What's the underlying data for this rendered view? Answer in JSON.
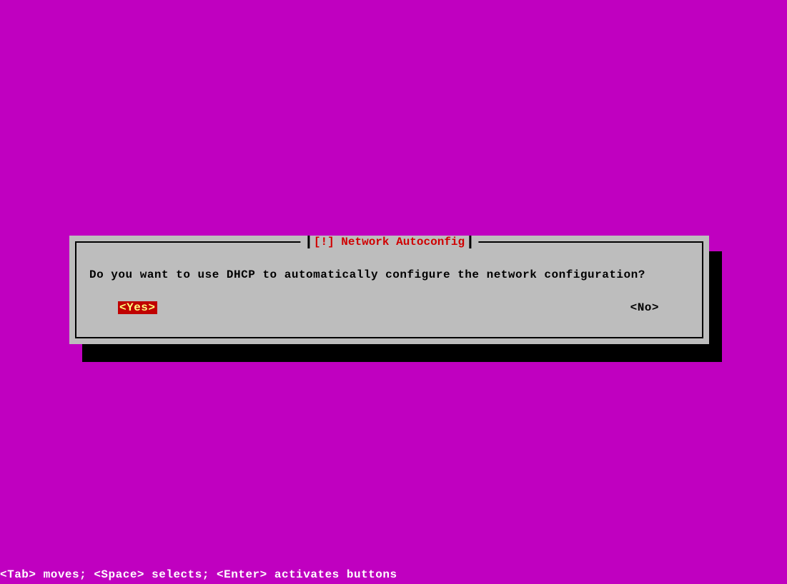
{
  "dialog": {
    "title": "[!] Network Autoconfig",
    "message": "Do you want to use DHCP to automatically configure the network configuration?",
    "yes_label": "<Yes>",
    "no_label": "<No>"
  },
  "footer": {
    "hint": "<Tab> moves; <Space> selects; <Enter> activates buttons"
  }
}
